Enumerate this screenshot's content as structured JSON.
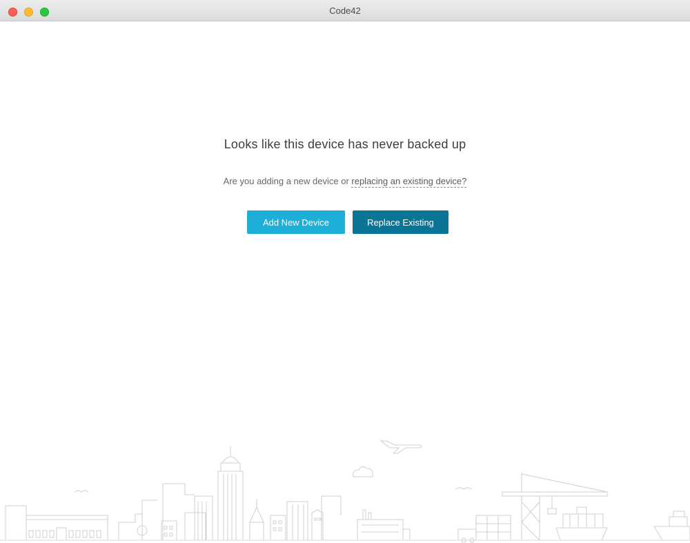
{
  "window": {
    "title": "Code42"
  },
  "main": {
    "heading": "Looks like this device has never backed up",
    "question_prefix": "Are you adding a new device or ",
    "question_link": "replacing an existing device?",
    "add_button_label": "Add New Device",
    "replace_button_label": "Replace Existing"
  },
  "colors": {
    "add_button": "#1eafd8",
    "replace_button": "#0a7594",
    "illustration_stroke": "#c9c9c9"
  }
}
